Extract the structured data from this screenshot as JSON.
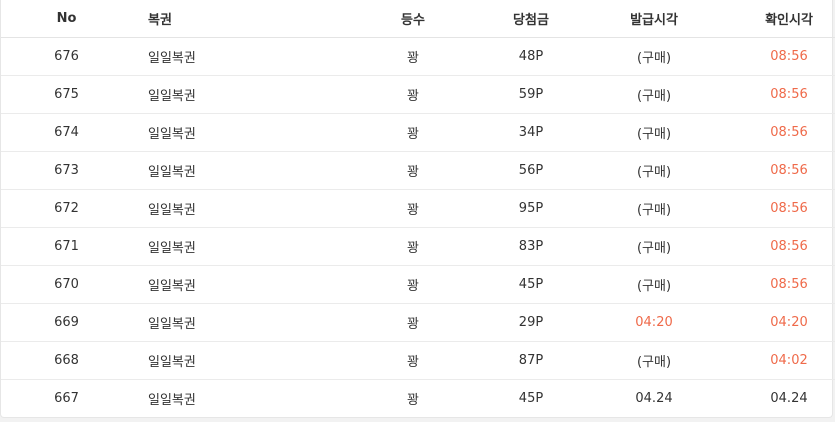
{
  "table": {
    "headers": {
      "no": "No",
      "name": "복권",
      "rank": "등수",
      "prize": "당첨금",
      "issued": "발급시각",
      "checked": "확인시각"
    },
    "rows": [
      {
        "no": "676",
        "name": "일일복권",
        "rank": "꽝",
        "prize": "48P",
        "issued": "(구매)",
        "checked": "08:56"
      },
      {
        "no": "675",
        "name": "일일복권",
        "rank": "꽝",
        "prize": "59P",
        "issued": "(구매)",
        "checked": "08:56"
      },
      {
        "no": "674",
        "name": "일일복권",
        "rank": "꽝",
        "prize": "34P",
        "issued": "(구매)",
        "checked": "08:56"
      },
      {
        "no": "673",
        "name": "일일복권",
        "rank": "꽝",
        "prize": "56P",
        "issued": "(구매)",
        "checked": "08:56"
      },
      {
        "no": "672",
        "name": "일일복권",
        "rank": "꽝",
        "prize": "95P",
        "issued": "(구매)",
        "checked": "08:56"
      },
      {
        "no": "671",
        "name": "일일복권",
        "rank": "꽝",
        "prize": "83P",
        "issued": "(구매)",
        "checked": "08:56"
      },
      {
        "no": "670",
        "name": "일일복권",
        "rank": "꽝",
        "prize": "45P",
        "issued": "(구매)",
        "checked": "08:56"
      },
      {
        "no": "669",
        "name": "일일복권",
        "rank": "꽝",
        "prize": "29P",
        "issued": "04:20",
        "checked": "04:20"
      },
      {
        "no": "668",
        "name": "일일복권",
        "rank": "꽝",
        "prize": "87P",
        "issued": "(구매)",
        "checked": "04:02"
      },
      {
        "no": "667",
        "name": "일일복권",
        "rank": "꽝",
        "prize": "45P",
        "issued": "04.24",
        "checked": "04.24"
      }
    ]
  },
  "colors": {
    "highlight_time": "#ef6a4a",
    "text": "#333333"
  }
}
